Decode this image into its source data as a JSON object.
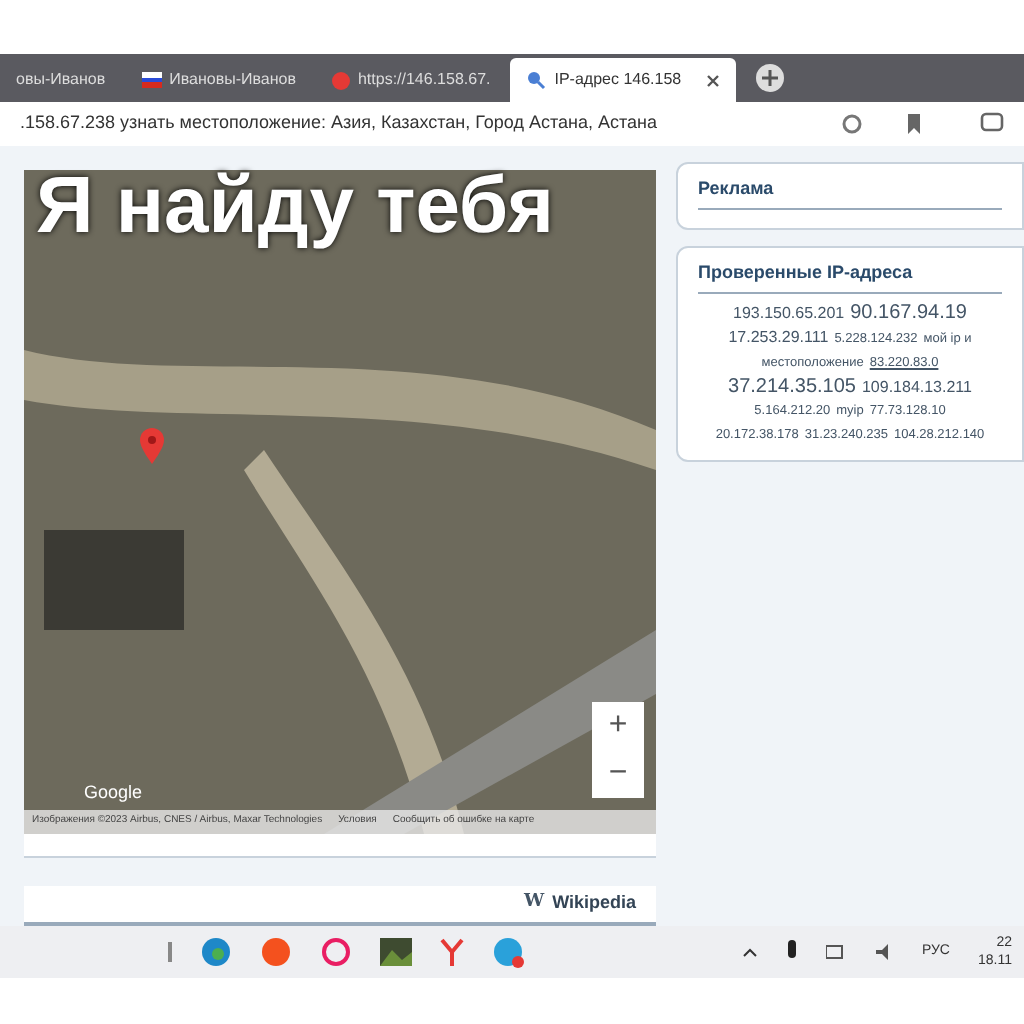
{
  "tabs": [
    {
      "label": "овы-Иванов",
      "kind": "plain",
      "selected": false
    },
    {
      "label": "Ивановы-Иванов",
      "kind": "flag",
      "selected": false
    },
    {
      "label": "https://146.158.67.",
      "kind": "dot",
      "selected": false
    },
    {
      "label": "IP-адрес 146.158",
      "kind": "search",
      "selected": true
    }
  ],
  "address": ".158.67.238 узнать местоположение: Азия, Казахстан, Город Астана, Астана",
  "caption": "Я найду тебя",
  "map": {
    "logo": "Google",
    "attribution": [
      "Изображения ©2023 Airbus, CNES / Airbus, Maxar Technologies",
      "Условия",
      "Сообщить об ошибке на карте"
    ],
    "zoom_in": "+",
    "zoom_out": "−"
  },
  "ads": {
    "title": "Реклама"
  },
  "checked": {
    "title": "Проверенные IP-адреса",
    "lines": [
      [
        {
          "t": "193.150.65.201",
          "link": false
        },
        {
          "t": "90.167.94.19",
          "link": false
        }
      ],
      [
        {
          "t": "17.253.29.111",
          "link": false
        },
        {
          "t": "5.228.124.232",
          "link": false
        },
        {
          "t": "мой ip и",
          "link": false
        }
      ],
      [
        {
          "t": "местоположение",
          "link": false
        },
        {
          "t": "83.220.83.0",
          "link": true
        }
      ],
      [
        {
          "t": "37.214.35.105",
          "link": false
        },
        {
          "t": "109.184.13.211",
          "link": false
        }
      ],
      [
        {
          "t": "5.164.212.20",
          "link": false
        },
        {
          "t": "myip",
          "link": false
        },
        {
          "t": "77.73.128.10",
          "link": false
        }
      ],
      [
        {
          "t": "20.172.38.178",
          "link": false
        },
        {
          "t": "31.23.240.235",
          "link": false
        },
        {
          "t": "104.28.212.140",
          "link": false
        }
      ]
    ]
  },
  "wiki": {
    "letter": "W",
    "label": "Wikipedia"
  },
  "taskbar": {
    "lang": "РУС",
    "time": "22",
    "date": "18.11"
  }
}
